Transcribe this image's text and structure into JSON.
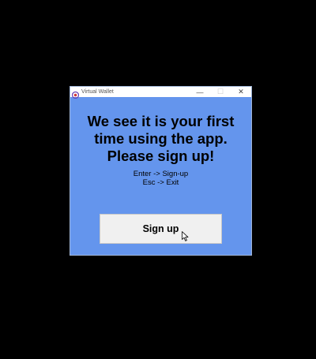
{
  "window": {
    "title": "Virtual Wallet",
    "controls": {
      "minimize": "—",
      "maximize": "☐",
      "close": "✕"
    }
  },
  "message": {
    "line1": "We see it is your first",
    "line2": "time using the app.",
    "line3": "Please sign up!"
  },
  "hints": {
    "enter": "Enter -> Sign-up",
    "escape": "Esc -> Exit"
  },
  "signup_button": {
    "label": "Sign up"
  },
  "colors": {
    "desktop": "#000000",
    "window_background": "#6495ed",
    "button_background": "#f0f0f0"
  },
  "icons": {
    "app": "wallet-app-icon",
    "cursor": "arrow-cursor-icon"
  }
}
